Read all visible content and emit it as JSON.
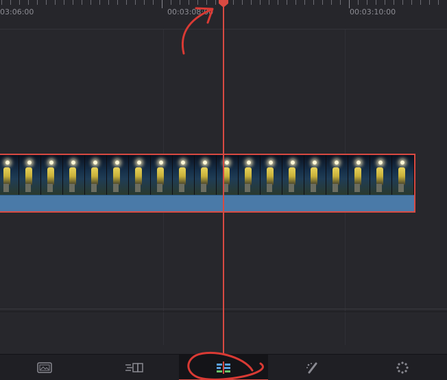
{
  "ruler": {
    "timecodes": [
      "03:06:00",
      "00:03:08:00",
      "00:03:10:00"
    ]
  },
  "clip": {
    "video_track": "video-clip",
    "audio_track": "audio-clip",
    "frame_count": 19
  },
  "playhead": {
    "color": "#d94a42"
  },
  "pagebar": {
    "pages": [
      {
        "name": "media-page-icon"
      },
      {
        "name": "cut-page-icon"
      },
      {
        "name": "edit-page-icon",
        "active": true
      },
      {
        "name": "fusion-page-icon"
      },
      {
        "name": "color-page-icon"
      }
    ]
  },
  "colors": {
    "accent": "#d94a42",
    "audio": "#4a7aa8",
    "background": "#28282e"
  }
}
